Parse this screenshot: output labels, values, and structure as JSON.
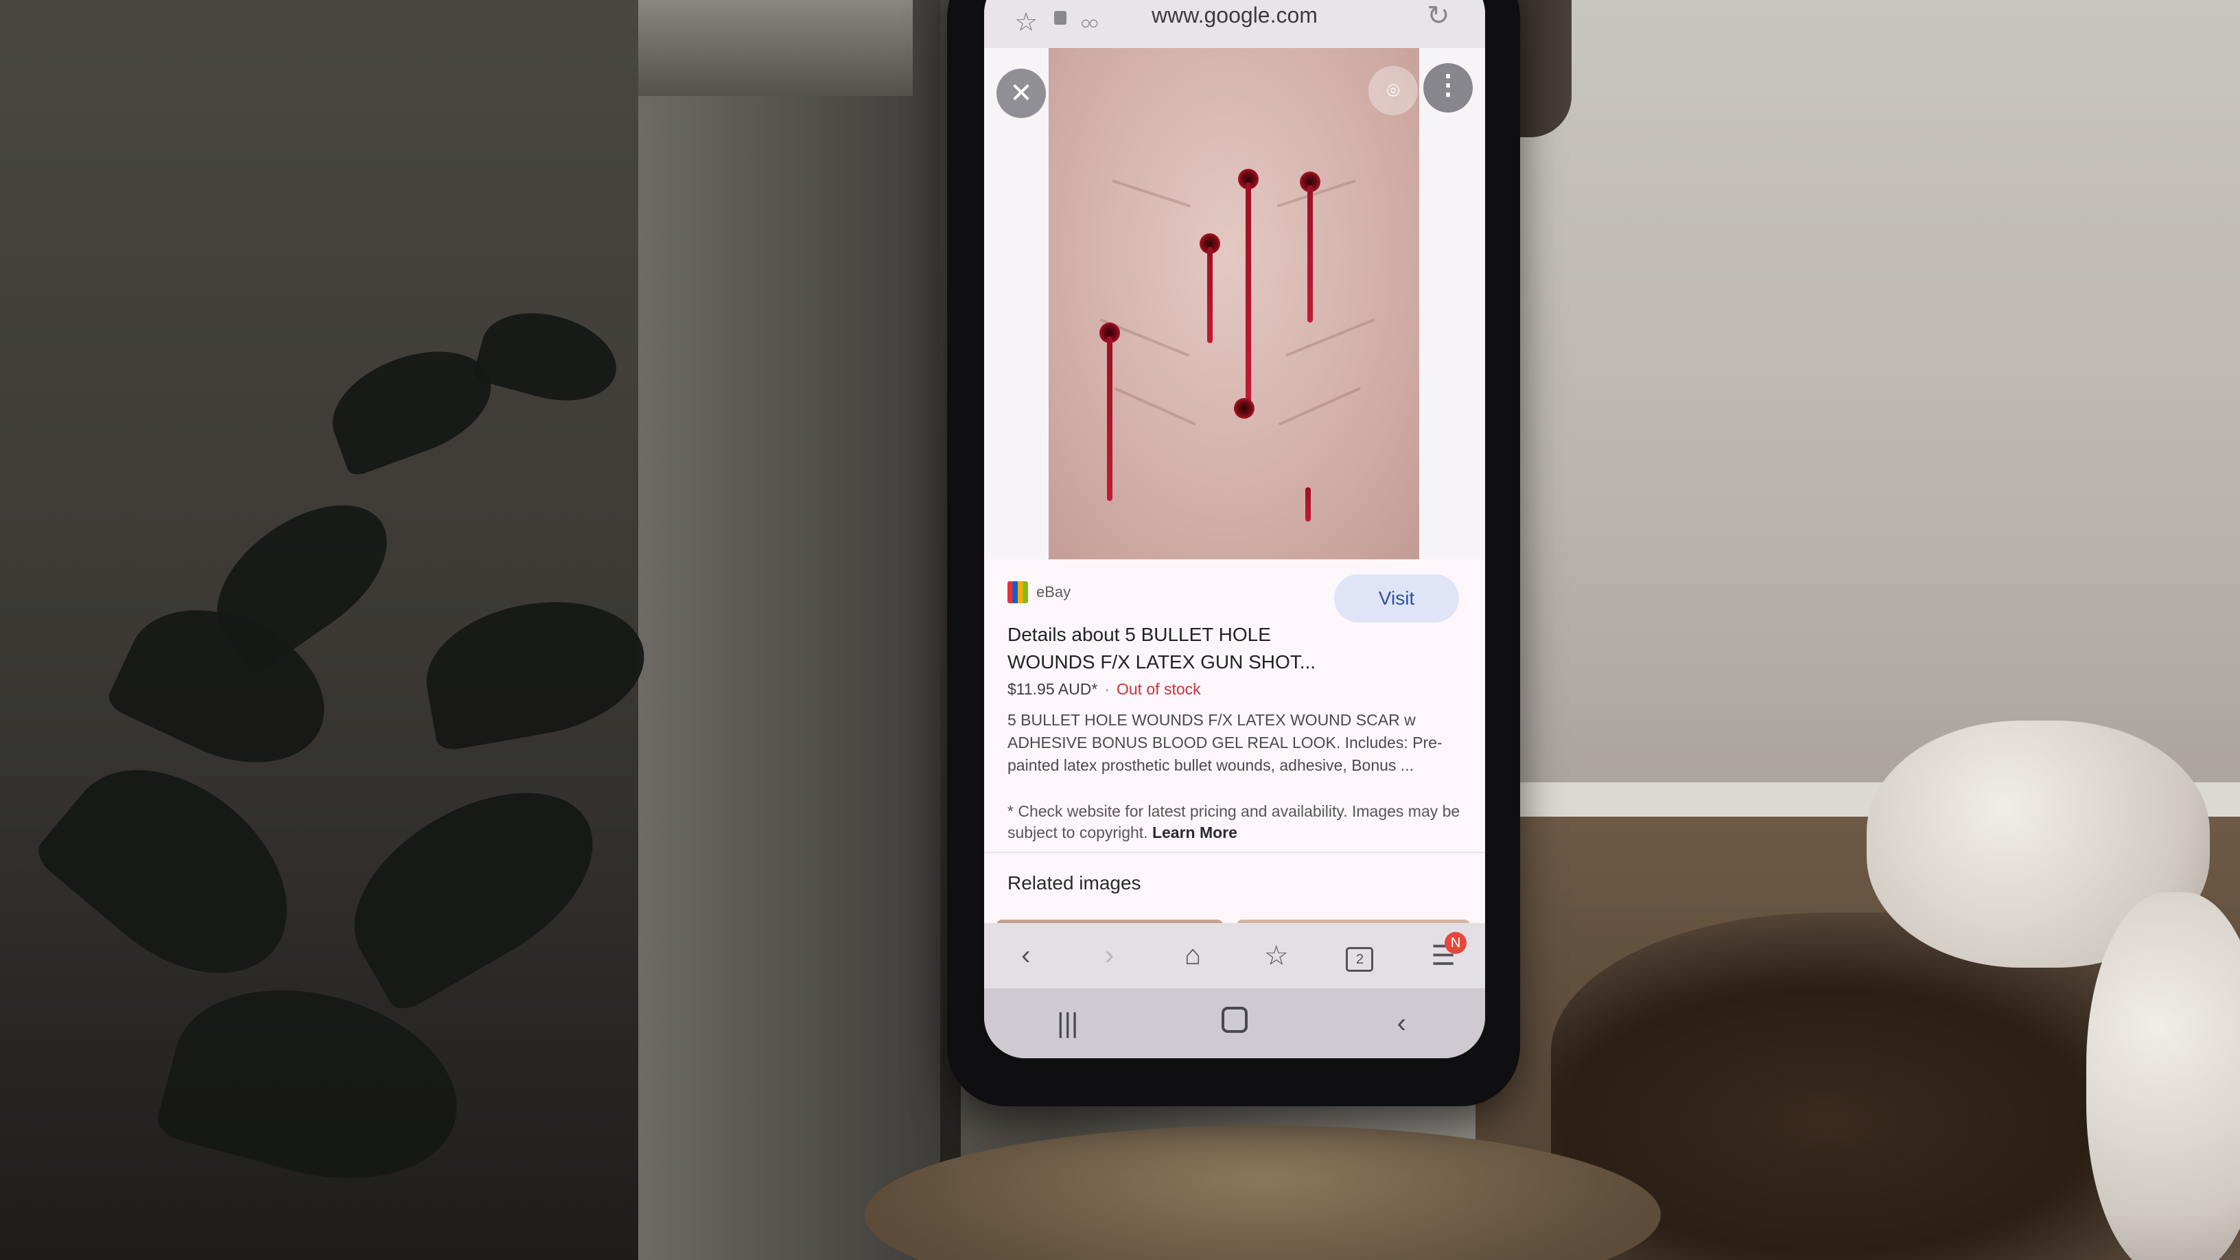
{
  "browser": {
    "url": "www.google.com",
    "tab_count": "2",
    "menu_badge": "N"
  },
  "result": {
    "source": "eBay",
    "visit_label": "Visit",
    "title": "Details about 5 BULLET HOLE WOUNDS F/X LATEX GUN SHOT...",
    "price": "$11.95 AUD*",
    "separator": "·",
    "stock_status": "Out of stock",
    "description": "5 BULLET HOLE WOUNDS F/X LATEX WOUND SCAR w ADHESIVE BONUS BLOOD GEL REAL LOOK. Includes: Pre-painted latex prosthetic bullet wounds, adhesive, Bonus ...",
    "disclaimer": "* Check website for latest pricing and availability. Images may be subject to copyright.",
    "learn_more": "Learn More",
    "related_heading": "Related images"
  },
  "icons": {
    "close": "close-icon",
    "lens": "lens-icon",
    "more": "more-vert-icon",
    "back": "back-icon",
    "forward": "forward-icon",
    "home": "home-icon",
    "bookmarks": "bookmarks-icon",
    "tabs": "tabs-icon",
    "menu": "menu-icon"
  },
  "colors": {
    "visit_button": "#dfe4f7",
    "stock_out": "#c5323b",
    "badge": "#e4483c"
  }
}
